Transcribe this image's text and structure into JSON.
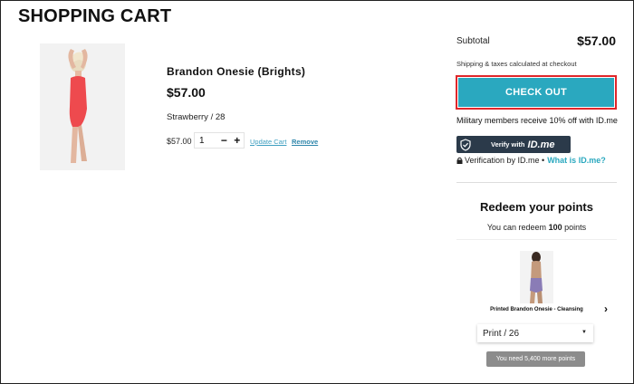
{
  "header": {
    "title": "SHOPPING CART"
  },
  "cart": {
    "item": {
      "name": "Brandon Onesie (Brights)",
      "price": "$57.00",
      "variant": "Strawberry / 28",
      "line_price": "$57.00",
      "quantity": "1",
      "decrement": "−",
      "increment": "+",
      "update_label": "Update Cart",
      "remove_label": "Remove"
    }
  },
  "summary": {
    "subtotal_label": "Subtotal",
    "subtotal_value": "$57.00",
    "shipping_note": "Shipping & taxes calculated at checkout",
    "checkout_label": "CHECK OUT",
    "military_text": "Military members receive 10% off with ID.me",
    "idme_button_label": "Verify with",
    "idme_brand": "ID.me",
    "verification_text": "Verification by ID.me •",
    "what_is_link": "What is ID.me?"
  },
  "rewards": {
    "title": "Redeem your points",
    "subtitle_prefix": "You can redeem",
    "points": "100",
    "subtitle_suffix": "points",
    "item_name": "Printed Brandon Onesie - Cleansing",
    "selected_variant": "Print / 26",
    "need_points": "You need 5,400 more points",
    "next_arrow": "›"
  },
  "colors": {
    "accent": "#2aa8bf",
    "highlight_border": "#e0262a",
    "idme_bg": "#2b3a4a",
    "swimsuit": "#ee4a4e",
    "disabled_button": "#8c8c8c"
  }
}
